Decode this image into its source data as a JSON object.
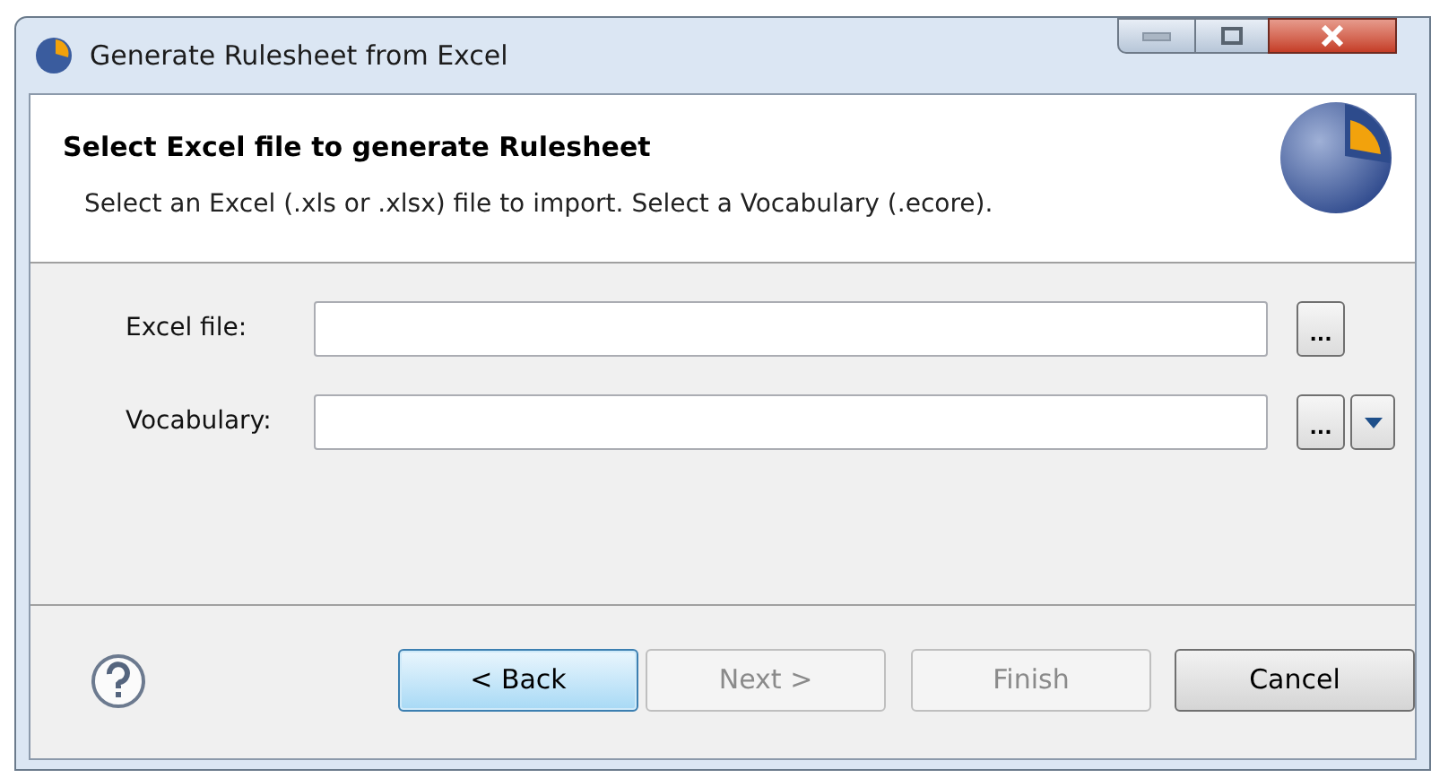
{
  "window": {
    "title": "Generate Rulesheet from Excel"
  },
  "header": {
    "title": "Select Excel file to generate Rulesheet",
    "description": "Select an Excel (.xls or .xlsx) file to import. Select a Vocabulary (.ecore)."
  },
  "fields": [
    {
      "label": "Excel file:",
      "kind": "browse",
      "browse_button": "..."
    },
    {
      "label": "Vocabulary:",
      "kind": "browse_dropdown",
      "browse_button": "..."
    }
  ],
  "buttons": [
    {
      "label": "< Back",
      "disabled": false,
      "default": true
    },
    {
      "label": "Next >",
      "disabled": true,
      "default": false
    },
    {
      "label": "Finish",
      "disabled": true,
      "default": false
    },
    {
      "label": "Cancel",
      "disabled": false,
      "default": false
    }
  ]
}
